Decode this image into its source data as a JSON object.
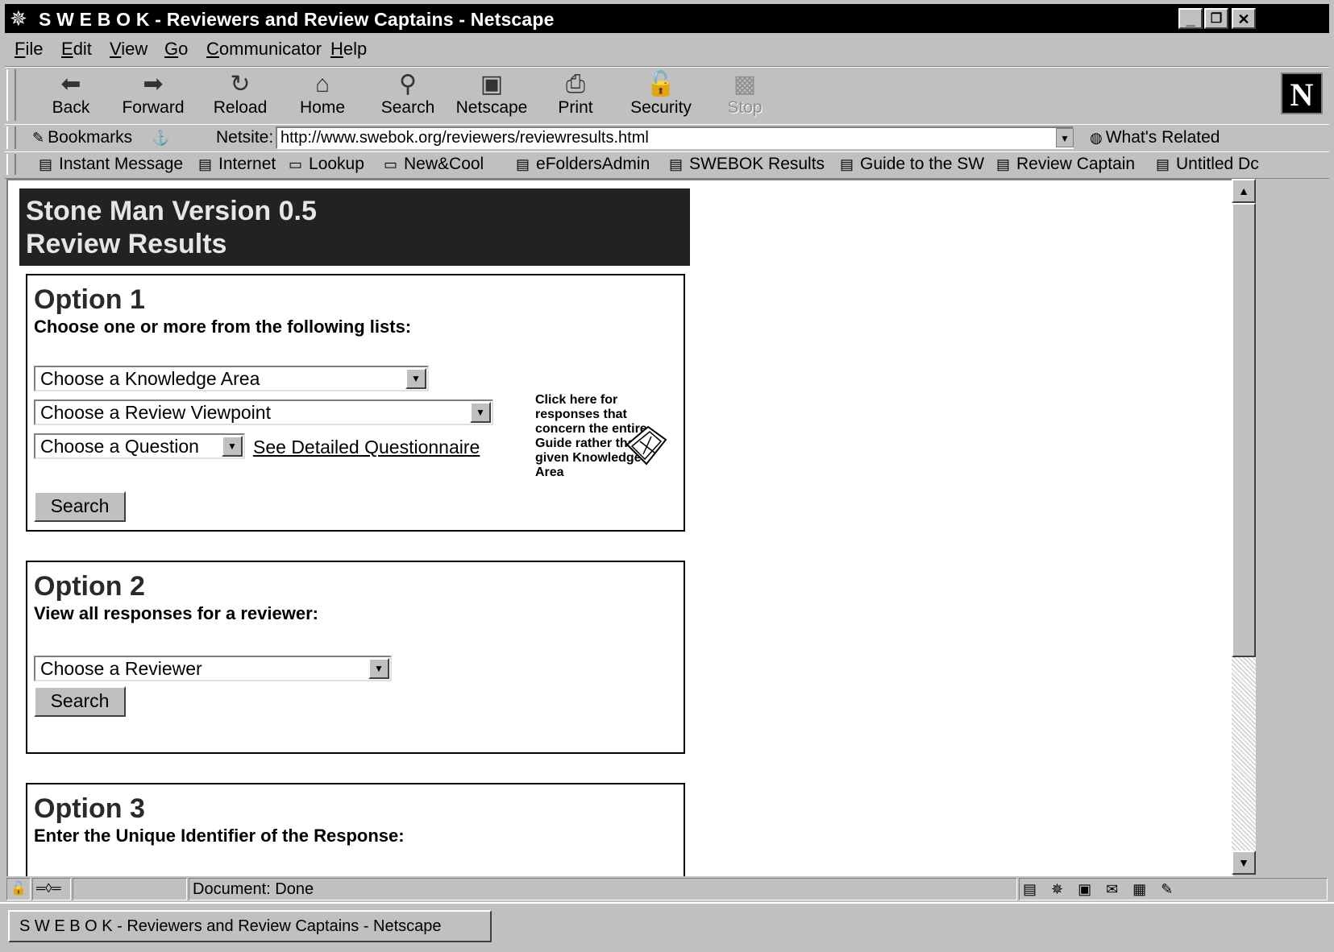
{
  "window": {
    "title": "S W E B O K - Reviewers and Review Captains - Netscape",
    "controls": {
      "minimize": "_",
      "restore": "❐",
      "close": "✕"
    }
  },
  "menubar": [
    "File",
    "Edit",
    "View",
    "Go",
    "Communicator",
    "Help"
  ],
  "navbar": {
    "buttons": [
      {
        "label": "Back",
        "icon": "back-arrow-icon",
        "glyph": "⬅"
      },
      {
        "label": "Forward",
        "icon": "forward-arrow-icon",
        "glyph": "➡"
      },
      {
        "label": "Reload",
        "icon": "reload-icon",
        "glyph": "↻"
      },
      {
        "label": "Home",
        "icon": "home-icon",
        "glyph": "⌂"
      },
      {
        "label": "Search",
        "icon": "search-icon",
        "glyph": "⚲"
      },
      {
        "label": "Netscape",
        "icon": "my-netscape-icon",
        "glyph": "▣"
      },
      {
        "label": "Print",
        "icon": "printer-icon",
        "glyph": "⎙"
      },
      {
        "label": "Security",
        "icon": "lock-icon",
        "glyph": "🔓"
      },
      {
        "label": "Stop",
        "icon": "stop-icon",
        "glyph": "▩",
        "disabled": true
      }
    ],
    "logo": "N"
  },
  "location": {
    "bookmarks_label": "Bookmarks",
    "netsite_label": "Netsite:",
    "url": "http://www.swebok.org/reviewers/reviewresults.html",
    "related_label": "What's Related"
  },
  "personal_toolbar": [
    "Instant Message",
    "Internet",
    "Lookup",
    "New&Cool",
    "eFoldersAdmin",
    "SWEBOK Results",
    "Guide to the SW",
    "Review Captain",
    "Untitled Dc"
  ],
  "page": {
    "header_line1": "Stone Man Version 0.5",
    "header_line2": "Review Results",
    "option1": {
      "title": "Option 1",
      "subtitle": "Choose one or more from the following lists:",
      "knowledge_area": "Choose a Knowledge Area",
      "review_viewpoint": "Choose a Review Viewpoint",
      "question": "Choose a Question",
      "detailed_link": "See Detailed Questionnaire",
      "guide_note": "Click here for responses that concern the entire Guide rather than a given Knowledge Area",
      "search": "Search"
    },
    "option2": {
      "title": "Option 2",
      "subtitle": "View all responses for a reviewer:",
      "reviewer": "Choose a Reviewer",
      "search": "Search"
    },
    "option3": {
      "title": "Option 3",
      "subtitle": "Enter the Unique Identifier of the Response:"
    }
  },
  "statusbar": {
    "status": "Document: Done"
  },
  "taskbar": {
    "active_task": "S W E B O K - Reviewers and Review Captains - Netscape"
  }
}
